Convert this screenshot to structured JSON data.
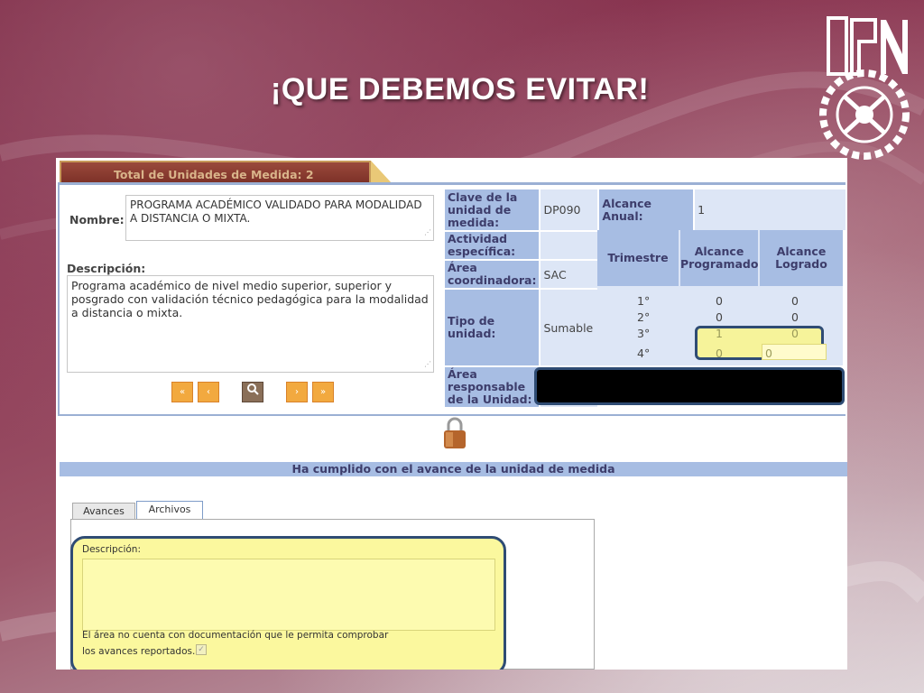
{
  "slide": {
    "title": "¡QUE DEBEMOS EVITAR!",
    "logo_text": "IPN"
  },
  "screenshot": {
    "header_tab": "Total de Unidades de Medida: 2",
    "nombre_label": "Nombre:",
    "nombre_value": "PROGRAMA ACADÉMICO VALIDADO PARA MODALIDAD A DISTANCIA O MIXTA.",
    "descripcion_label": "Descripción:",
    "descripcion_value": "Programa académico de nivel medio superior, superior y posgrado con validación técnico pedagógica para la modalidad a distancia o mixta.",
    "nav_buttons": [
      "«",
      "‹",
      "search",
      "›",
      "»"
    ],
    "fields": {
      "clave_label": "Clave de la unidad de medida:",
      "clave_value": "DP090",
      "alcance_anual_label": "Alcance Anual:",
      "alcance_anual_value": "1",
      "actividad_label": "Actividad específica:",
      "actividad_value": "",
      "area_coord_label": "Área coordinadora:",
      "area_coord_value": "SAC",
      "tipo_label": "Tipo de unidad:",
      "tipo_value": "Sumable",
      "area_resp_label": "Área responsable de la Unidad:"
    },
    "trimestres": {
      "col_trimestre": "Trimestre",
      "col_programado": "Alcance Programado",
      "col_logrado": "Alcance Logrado",
      "rows": [
        {
          "t": "1°",
          "p": "0",
          "l": "0"
        },
        {
          "t": "2°",
          "p": "0",
          "l": "0"
        },
        {
          "t": "3°",
          "p": "1",
          "l": "0"
        },
        {
          "t": "4°",
          "p": "0",
          "l": "0"
        }
      ]
    },
    "status_bar": "Ha cumplido con el avance de la unidad de medida",
    "tabs": [
      "Avances",
      "Archivos"
    ],
    "archivos": {
      "descripcion_label": "Descripción:",
      "note_line1": "El área no cuenta con documentación que le permita comprobar",
      "note_line2": "los avances reportados.",
      "checkbox_checked": true
    }
  },
  "colors": {
    "header_blue": "#a7bde3",
    "value_blue": "#dde6f6",
    "highlight_yellow": "#fbf89e",
    "nav_orange": "#f2a93f"
  }
}
